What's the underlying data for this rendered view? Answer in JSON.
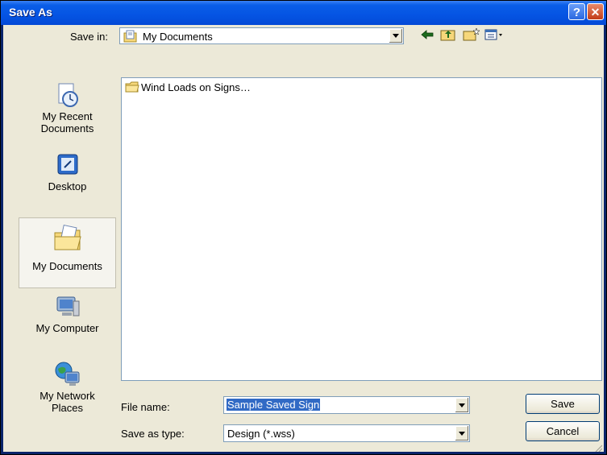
{
  "window": {
    "title": "Save As"
  },
  "titlebar": {
    "help": "?",
    "close": "✕"
  },
  "toolbar": {
    "save_in_label": "Save in:",
    "save_in_value": "My Documents"
  },
  "places": [
    {
      "label": "My Recent Documents",
      "label_line1": "My Recent",
      "label_line2": "Documents"
    },
    {
      "label": "Desktop"
    },
    {
      "label": "My Documents"
    },
    {
      "label": "My Computer"
    },
    {
      "label": "My Network Places",
      "label_line1": "My Network",
      "label_line2": "Places"
    }
  ],
  "files": [
    {
      "name": "Wind Loads on Signs…"
    }
  ],
  "form": {
    "file_name_label": "File name:",
    "file_name_value": "Sample Saved Sign",
    "save_as_type_label": "Save as type:",
    "save_as_type_value": "Design (*.wss)"
  },
  "buttons": {
    "save": "Save",
    "cancel": "Cancel"
  }
}
